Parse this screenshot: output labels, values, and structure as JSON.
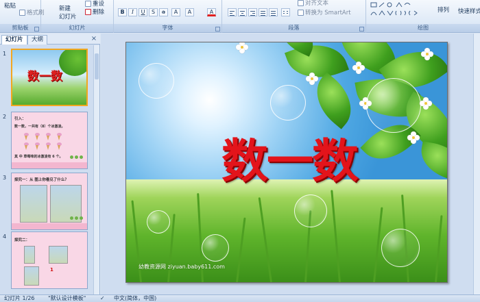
{
  "ribbon": {
    "clipboard": {
      "paste_label": "粘贴",
      "copy_format_label": "格式刷",
      "group_label": "剪贴板"
    },
    "slides": {
      "new_slide_label": "新建",
      "new_slide_label2": "幻灯片",
      "reset_label": "重设",
      "delete_label": "删除",
      "group_label": "幻灯片"
    },
    "font": {
      "group_label": "字体"
    },
    "paragraph": {
      "align_text_label": "对齐文本",
      "smartart_label": "转换为 SmartArt",
      "group_label": "段落"
    },
    "drawing": {
      "arrange_label": "排列",
      "quick_styles_label": "快速样式",
      "group_label": "绘图"
    }
  },
  "left_pane": {
    "tabs": [
      "幻灯片",
      "大纲"
    ],
    "close_glyph": "×",
    "slides": [
      {
        "number": "1",
        "title": "数一数"
      },
      {
        "number": "2",
        "line1": "引入：",
        "line2": "数一数，一共有（8）个冰激凌。",
        "line3": "其 中 草莓味的冰激凌有 6 个。"
      },
      {
        "number": "3",
        "line1": "探究一：从 图上你看见了什么？"
      },
      {
        "number": "4",
        "line1": "探究二：",
        "digit": "1"
      }
    ]
  },
  "slide": {
    "title": "数一数",
    "watermark": "幼教资源网 ziyuan.baby611.com"
  },
  "status_bar": {
    "slide_counter": "幻灯片 1/26",
    "theme": "\"默认设计模板\"",
    "language": "中文(简体，中国)"
  }
}
